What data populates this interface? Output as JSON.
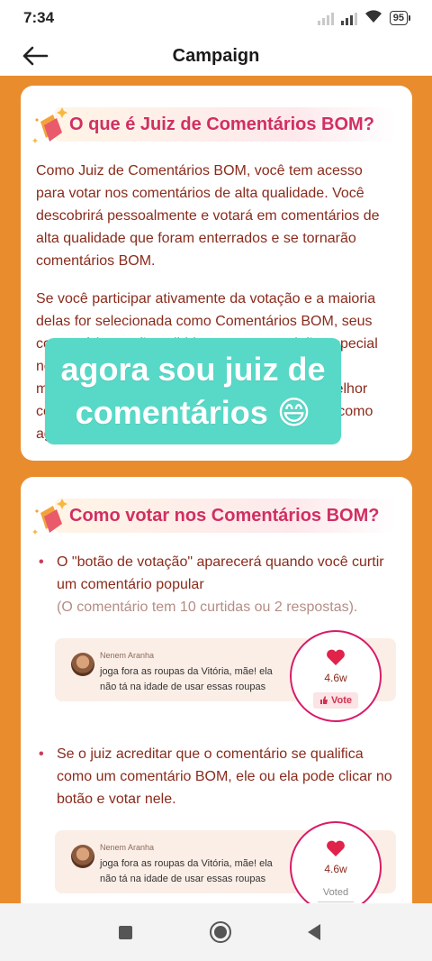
{
  "status_bar": {
    "time": "7:34",
    "battery": "95"
  },
  "header": {
    "title": "Campaign"
  },
  "colors": {
    "accent_orange": "#e88c2e",
    "title_pink": "#d12f62",
    "body_brown": "#8a2b1c",
    "overlay_teal": "#58d9c8"
  },
  "card1": {
    "title": "O que é Juiz de Comentários BOM?",
    "paragraph1": "Como Juiz de Comentários BOM, você tem acesso para votar nos comentários de alta qualidade. Você descobrirá pessoalmente e votará em comentários de alta qualidade que foram enterrados e se tornarão comentários BOM.",
    "paragraph2": "Se você participar ativamente da votação e a maioria delas for selecionada como Comentários BOM, seus comentários serão exibidos em uma posição especial nos vídeos e você será um Juiz de Kwai! Nós mostraremos a sua participação junto com o melhor comentário e você receberá de nós um prêmio como agradecimento especial."
  },
  "overlay": {
    "line1": "agora sou juiz de",
    "line2": "comentários 😄"
  },
  "card2": {
    "title": "Como votar nos Comentários BOM?",
    "bullet1": "O \"botão de votação\" aparecerá quando você curtir um comentário popular",
    "bullet1_note": "(O comentário tem 10 curtidas ou 2 respostas).",
    "bullet2": "Se o juiz acreditar que o comentário se qualifica como um comentário BOM, ele ou ela pode clicar no botão e votar nele.",
    "example1": {
      "name": "Nenem Aranha",
      "text": "joga fora as roupas da Vitória, mãe! ela não tá na idade de usar essas roupas",
      "likes": "4.6w",
      "vote_label": "Vote"
    },
    "example2": {
      "name": "Nenem Aranha",
      "text": "joga fora as roupas da Vitória, mãe! ela não tá na idade de usar essas roupas",
      "likes": "4.6w",
      "voted_label": "Voted"
    }
  },
  "icons": {
    "back": "arrow-left-icon",
    "title_decoration": "sparkle-flag-icon",
    "like": "heart-icon",
    "thumb": "thumbs-up-icon"
  }
}
